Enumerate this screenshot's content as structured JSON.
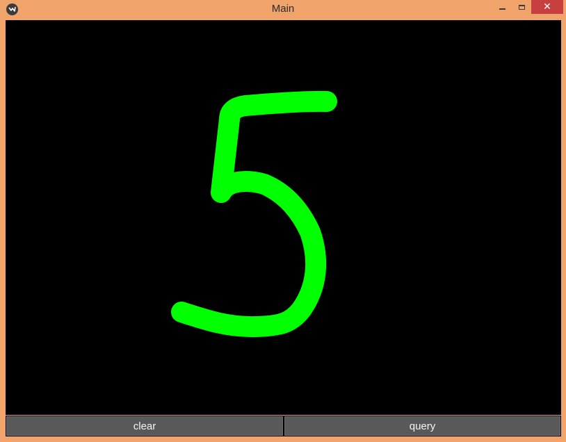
{
  "window": {
    "title": "Main",
    "icon": "kivy-logo-icon",
    "controls": {
      "minimize_icon": "minimize-icon",
      "maximize_icon": "maximize-icon",
      "close_icon": "close-icon",
      "close_glyph": "✕"
    }
  },
  "canvas": {
    "background": "#000000",
    "stroke_color": "#00ff00"
  },
  "buttons": {
    "clear_label": "clear",
    "query_label": "query"
  },
  "colors": {
    "frame": "#f0a36a",
    "close_bg": "#c7403f",
    "button_bg": "#595959"
  }
}
